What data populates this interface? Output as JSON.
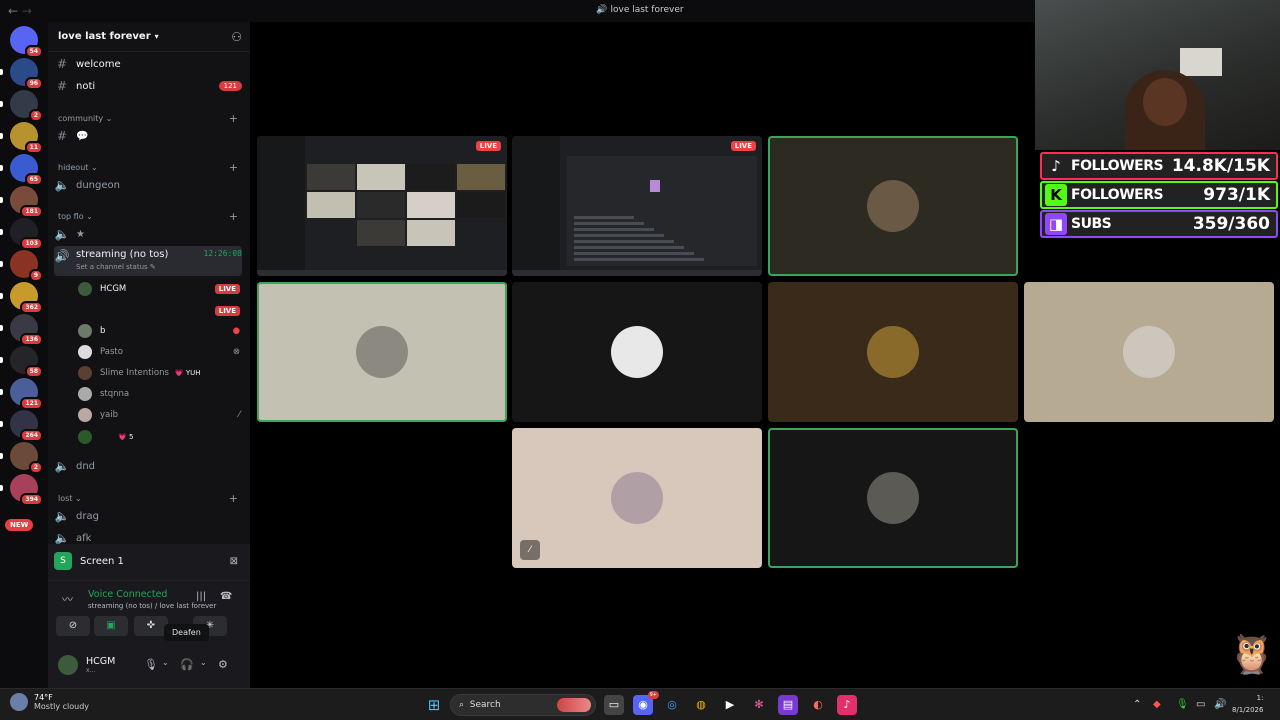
{
  "window": {
    "title": "love last forever",
    "nav_back": "←",
    "nav_fwd": "→"
  },
  "servers": {
    "items": [
      {
        "name": "direct-messages",
        "badge": "54",
        "color": "#5865f2"
      },
      {
        "name": "server-2",
        "badge": "96",
        "color": "#2b4a8a"
      },
      {
        "name": "server-3",
        "badge": "2",
        "color": "#333a48"
      },
      {
        "name": "server-hollywood",
        "badge": "11",
        "color": "#b8922e"
      },
      {
        "name": "server-5",
        "badge": "65",
        "color": "#3b5bd1"
      },
      {
        "name": "server-6",
        "badge": "181",
        "color": "#7a4b3a"
      },
      {
        "name": "server-7",
        "badge": "103",
        "color": "#1f1f25"
      },
      {
        "name": "server-chapo",
        "badge": "9",
        "color": "#8a3322"
      },
      {
        "name": "server-9",
        "badge": "362",
        "color": "#c79a2a"
      },
      {
        "name": "server-10",
        "badge": "136",
        "color": "#3a3a45"
      },
      {
        "name": "server-11",
        "badge": "58",
        "color": "#252529"
      },
      {
        "name": "server-12",
        "badge": "121",
        "color": "#4a5e9a"
      },
      {
        "name": "server-13",
        "badge": "264",
        "color": "#333347"
      },
      {
        "name": "server-14",
        "badge": "2",
        "color": "#6b4a3a"
      },
      {
        "name": "server-15",
        "badge": "394",
        "color": "#a8405a"
      }
    ],
    "new_label": "NEW"
  },
  "guild": {
    "name": "love last forever"
  },
  "channels": {
    "welcome": "welcome",
    "noti": "noti",
    "noti_badge": "121",
    "cat_community": "community",
    "community_chat": "💬",
    "cat_hideout": "hideout",
    "dungeon": "dungeon",
    "cat_topflo": "top flo",
    "star": "★",
    "streaming": "streaming (no tos)",
    "streaming_time": "12:26:08",
    "status": "Set a channel status",
    "dnd": "dnd",
    "cat_lost": "lost",
    "drag": "drag",
    "afk": "afk"
  },
  "voice_users": [
    {
      "name": "HCGM",
      "right": "LIVE",
      "live": true
    },
    {
      "name": "",
      "right": "LIVE",
      "live": true
    },
    {
      "name": "b",
      "right": "●",
      "live": false
    },
    {
      "name": "Pasto",
      "right": "⊗",
      "live": false
    },
    {
      "name": "Slime Intentions",
      "right": "💗 YUH",
      "live": false
    },
    {
      "name": "stqnna",
      "right": "",
      "live": false
    },
    {
      "name": "yaib",
      "right": "⁄",
      "live": false
    },
    {
      "name": "",
      "right": "💗 5",
      "live": false
    }
  ],
  "panel": {
    "screen": "Screen 1",
    "vc_status": "Voice Connected",
    "vc_channel": "streaming (no tos) / love last forever",
    "tooltip": "Deafen",
    "username": "HCGM",
    "userstatus": "x..."
  },
  "tiles": [
    {
      "name": "stream-1",
      "live": "LIVE",
      "type": "screen"
    },
    {
      "name": "stream-2",
      "live": "LIVE",
      "type": "screen"
    },
    {
      "name": "user-tile-3",
      "bg": "#2d2a22",
      "av": "#6a5a45",
      "speaking": true
    },
    {
      "name": "user-tile-4",
      "bg": "#c2c1b2",
      "av": "#8c8a80",
      "speaking": true
    },
    {
      "name": "user-tile-5",
      "bg": "#161616",
      "av": "#e8e8e8",
      "speaking": false
    },
    {
      "name": "user-tile-6",
      "bg": "#3a2a1a",
      "av": "#8a6a2a",
      "speaking": false
    },
    {
      "name": "user-tile-7",
      "bg": "#b6ab92",
      "av": "#ccc6bd",
      "speaking": false
    },
    {
      "name": "user-tile-8",
      "bg": "#d8c8bc",
      "av": "#b0a0a5",
      "speaking": false,
      "muted": true
    },
    {
      "name": "user-tile-9",
      "bg": "#161616",
      "av": "#5c5a55",
      "speaking": true
    }
  ],
  "overlay": {
    "tiktok_label": "FOLLOWERS",
    "tiktok_value": "14.8K/15K",
    "kick_label": "FOLLOWERS",
    "kick_value": "973/1K",
    "twitch_label": "SUBS",
    "twitch_value": "359/360",
    "colors": {
      "tiktok": "#ff2d55",
      "kick": "#53fc18",
      "twitch": "#9146ff"
    }
  },
  "taskbar": {
    "temp": "74°F",
    "weather": "Mostly cloudy",
    "search": "Search",
    "discord_badge": "9+",
    "clock_time": "1:",
    "clock_date": "8/1/2026"
  }
}
